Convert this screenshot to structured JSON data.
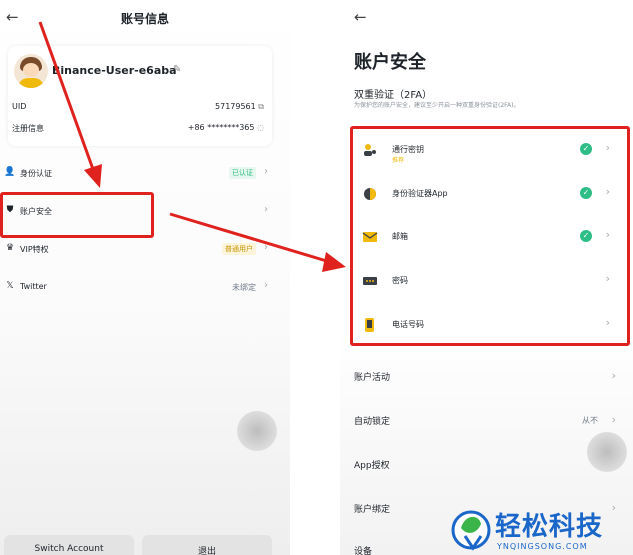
{
  "left": {
    "back_icon": "←",
    "title": "账号信息",
    "profile": {
      "username": "Binance-User-e6aba",
      "uid_label": "UID",
      "uid_value": "57179561",
      "reg_label": "注册信息",
      "reg_value": "+86 ********365"
    },
    "menu": [
      {
        "icon": "user-icon",
        "glyph": "👤",
        "label": "身份认证",
        "badge": "已认证",
        "value": ""
      },
      {
        "icon": "shield-icon",
        "glyph": "⛊",
        "label": "账户安全",
        "badge": "",
        "value": ""
      },
      {
        "icon": "vip-icon",
        "glyph": "♛",
        "label": "VIP特权",
        "badge": "普通用户",
        "value": ""
      },
      {
        "icon": "x-logo-icon",
        "glyph": "𝕏",
        "label": "Twitter",
        "badge": "",
        "value": "未绑定"
      }
    ],
    "buttons": {
      "switch_account": "Switch Account",
      "logout": "退出"
    }
  },
  "right": {
    "back_icon": "←",
    "title": "账户安全",
    "tfa_title": "双重验证（2FA）",
    "tfa_desc": "为保护您的账户安全，建议至少开启一种双重身份验证(2FA)。",
    "security_items": [
      {
        "icon": "passkey-icon",
        "label": "通行密钥",
        "sub": "推荐",
        "checked": true
      },
      {
        "icon": "authenticator-icon",
        "label": "身份验证器App",
        "sub": "",
        "checked": true
      },
      {
        "icon": "email-icon",
        "label": "邮箱",
        "sub": "",
        "checked": true
      },
      {
        "icon": "password-icon",
        "label": "密码",
        "sub": "",
        "checked": false
      },
      {
        "icon": "phone-icon",
        "label": "电话号码",
        "sub": "",
        "checked": false
      }
    ],
    "more_items": [
      {
        "label": "账户活动",
        "value": ""
      },
      {
        "label": "自动锁定",
        "value": "从不"
      },
      {
        "label": "App授权",
        "value": ""
      },
      {
        "label": "账户绑定",
        "value": ""
      },
      {
        "label": "设备",
        "value": ""
      }
    ]
  },
  "watermark": {
    "text": "轻松科技",
    "url": "YNQINGSONG.COM"
  },
  "colors": {
    "annotation": "#e0221e",
    "check": "#2ebd85",
    "accent": "#f0b90b",
    "watermark": "#1a66c9"
  }
}
